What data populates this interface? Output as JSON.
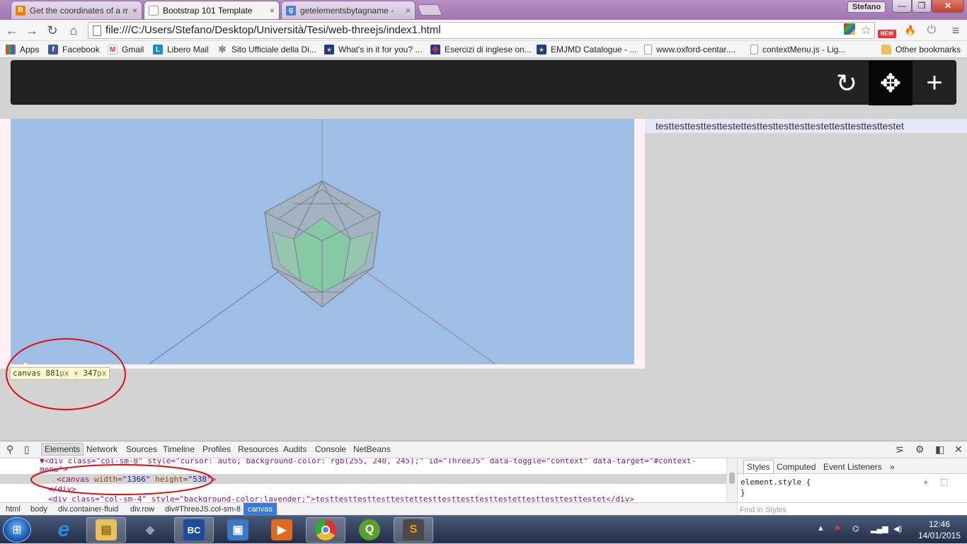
{
  "browser": {
    "tabs": [
      {
        "title": "Get the coordinates of a m",
        "favicon": "blogger-icon",
        "color": "#f57d00",
        "glyph": "B"
      },
      {
        "title": "Bootstrap 101 Template",
        "favicon": "page-icon",
        "color": "#ffffff",
        "glyph": ""
      },
      {
        "title": "getelementsbytagname -",
        "favicon": "google-icon",
        "color": "#4a7fe0",
        "glyph": "g"
      }
    ],
    "tab_close": "×",
    "user": "Stefano",
    "window_buttons": {
      "minimize": "—",
      "maximize": "❐",
      "close": "✕"
    },
    "nav": {
      "back": "←",
      "forward": "→",
      "reload": "↻",
      "home": "⌂"
    },
    "url": "file:///C:/Users/Stefano/Desktop/Università/Tesi/web-threejs/index1.html",
    "star": "☆",
    "extensions": [
      "puzzle-icon",
      "new-badge-icon",
      "flame-icon",
      "power-icon",
      "menu-icon"
    ],
    "ext_new": "NEW",
    "menu": "≡"
  },
  "bookmarks": [
    {
      "label": "Apps",
      "icon": "apps-icon",
      "color": "#d44"
    },
    {
      "label": "Facebook",
      "icon": "facebook-icon",
      "color": "#3b5998",
      "glyph": "f"
    },
    {
      "label": "Gmail",
      "icon": "gmail-icon",
      "color": "#d33",
      "glyph": "M"
    },
    {
      "label": "Libero Mail",
      "icon": "libero-icon",
      "color": "#1a8bd4",
      "glyph": "L"
    },
    {
      "label": "Sito Ufficiale della Di...",
      "icon": "gear-icon",
      "color": "#777",
      "glyph": "✻"
    },
    {
      "label": "What's in it for you? ...",
      "icon": "eu-flag-icon",
      "color": "#1a3a9e",
      "glyph": "★"
    },
    {
      "label": "Esercizi di inglese on...",
      "icon": "uk-flag-icon",
      "color": "#c33",
      "glyph": "✚"
    },
    {
      "label": "EMJMD Catalogue - ...",
      "icon": "eu-flag-icon",
      "color": "#1a3a9e",
      "glyph": "★"
    },
    {
      "label": "www.oxford-centar....",
      "icon": "page-icon",
      "color": "#ffffff",
      "glyph": ""
    },
    {
      "label": "contextMenu.js - Lig...",
      "icon": "page-icon",
      "color": "#ffffff",
      "glyph": ""
    },
    {
      "label": "Other bookmarks",
      "icon": "folder-icon",
      "color": "#e8c15a",
      "glyph": ""
    }
  ],
  "page": {
    "navbar_buttons": [
      {
        "name": "reload-icon",
        "glyph": "↻",
        "active": false
      },
      {
        "name": "move-icon",
        "glyph": "✥",
        "active": true
      },
      {
        "name": "plus-icon",
        "glyph": "+",
        "active": false
      }
    ],
    "side_text": "testtesttesttesttestettesttesttesttesttestettesttesttesttestet",
    "tooltip": {
      "tag": "canvas",
      "w": "881",
      "h": "347",
      "unit": "px",
      "times": "×"
    }
  },
  "devtools": {
    "tabs": [
      "Elements",
      "Network",
      "Sources",
      "Timeline",
      "Profiles",
      "Resources",
      "Audits",
      "Console",
      "NetBeans"
    ],
    "active_tab": "Elements",
    "dom_lines": [
      {
        "indent": 68,
        "text": "▼<div class=\"col-sm-8\" style=\"cursor: auto; background-color: rgb(255, 240, 245);\" id=\"ThreeJS\" data-toggle=\"context\" data-target=\"#context-"
      },
      {
        "indent": 56,
        "text": "menu\">"
      },
      {
        "indent": 80,
        "text_open": "<canvas ",
        "attr1": "width",
        "val1": "\"1366\"",
        "attr2": "height",
        "val2": "\"538\"",
        "text_close": ">"
      },
      {
        "indent": 68,
        "text": "</div>"
      },
      {
        "indent": 68,
        "text": "<div class=\"col-sm-4\" style=\"background-color:lavender;\">testtesttesttesttestettesttesttesttesttestettesttesttesttestet</div>"
      }
    ],
    "styles_tabs": [
      "Styles",
      "Computed",
      "Event Listeners",
      "»"
    ],
    "styles_code": "element.style {\n}",
    "find_placeholder": "Find in Styles",
    "breadcrumbs": [
      "html",
      "body",
      "div.container-fluid",
      "div.row",
      "div#ThreeJS.col-sm-8",
      "canvas"
    ]
  },
  "taskbar": {
    "apps": [
      {
        "name": "ie-icon",
        "color": "#1a7ad6",
        "glyph": "e"
      },
      {
        "name": "explorer-icon",
        "color": "#e8c15a",
        "glyph": "▤"
      },
      {
        "name": "app-icon",
        "color": "#556",
        "glyph": "◆"
      },
      {
        "name": "bc-icon",
        "color": "#1b4c9c",
        "glyph": "BC"
      },
      {
        "name": "virtualbox-icon",
        "color": "#3a78c0",
        "glyph": "▣"
      },
      {
        "name": "media-icon",
        "color": "#e06a1c",
        "glyph": "▶"
      },
      {
        "name": "chrome-icon",
        "color": "#4a9a3a",
        "glyph": "◉"
      },
      {
        "name": "qgis-icon",
        "color": "#5aa02c",
        "glyph": "Q"
      },
      {
        "name": "sublime-icon",
        "color": "#4a4a4a",
        "glyph": "S"
      }
    ],
    "time": "12:46",
    "date": "14/01/2015"
  }
}
